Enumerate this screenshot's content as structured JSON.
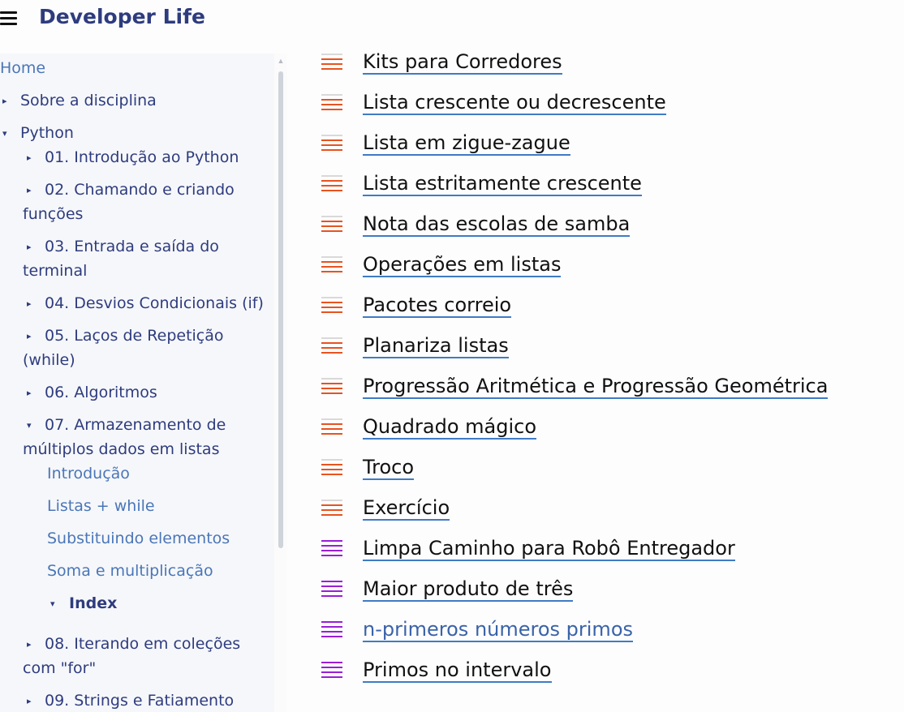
{
  "header": {
    "title": "Developer Life"
  },
  "sidebar": {
    "home": "Home",
    "sobre": "Sobre a disciplina",
    "python": "Python",
    "ch01": "01. Introdução ao Python",
    "ch02_l1": "02. Chamando e criando",
    "ch02_l2": "funções",
    "ch03_l1": "03. Entrada e saída do",
    "ch03_l2": "terminal",
    "ch04": "04. Desvios Condicionais (if)",
    "ch05_l1": "05. Laços de Repetição",
    "ch05_l2": "(while)",
    "ch06": "06. Algoritmos",
    "ch07_l1": "07. Armazenamento de",
    "ch07_l2": "múltiplos dados em listas",
    "sub_intro": "Introdução",
    "sub_while": "Listas + while",
    "sub_subst": "Substituindo elementos",
    "sub_soma": "Soma e multiplicação",
    "sub_index": "Index",
    "ch08_l1": "08. Iterando em coleções",
    "ch08_l2": "com \"for\"",
    "ch09": "09. Strings e Fatiamento"
  },
  "exercises": [
    {
      "label": "Kits para Corredores",
      "level": "orange"
    },
    {
      "label": "Lista crescente ou decrescente",
      "level": "orange"
    },
    {
      "label": "Lista em zigue-zague",
      "level": "orange"
    },
    {
      "label": "Lista estritamente crescente",
      "level": "orange"
    },
    {
      "label": "Nota das escolas de samba",
      "level": "orange"
    },
    {
      "label": "Operações em listas",
      "level": "orange"
    },
    {
      "label": "Pacotes correio",
      "level": "orange"
    },
    {
      "label": "Planariza listas",
      "level": "orange"
    },
    {
      "label": "Progressão Aritmética e Progressão Geométrica",
      "level": "orange"
    },
    {
      "label": "Quadrado mágico",
      "level": "orange"
    },
    {
      "label": "Troco",
      "level": "orange"
    },
    {
      "label": "Exercício",
      "level": "orange"
    },
    {
      "label": "Limpa Caminho para Robô Entregador",
      "level": "purple"
    },
    {
      "label": "Maior produto de três",
      "level": "purple"
    },
    {
      "label": "n-primeros números primos",
      "level": "purple"
    },
    {
      "label": "Primos no intervalo",
      "level": "purple"
    }
  ],
  "colors": {
    "accent": "#2e3c7e",
    "orange": "#e8531f",
    "purple": "#9a1fd6",
    "link": "#4a76b8"
  }
}
